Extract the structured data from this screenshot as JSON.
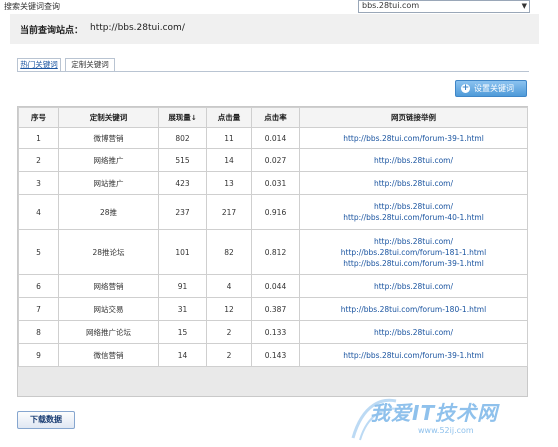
{
  "topbar": {
    "title": "搜索关键词查询",
    "site_select_value": "bbs.28tui.com"
  },
  "site": {
    "label": "当前查询站点：",
    "url": "http://bbs.28tui.com/"
  },
  "tabs": [
    {
      "label": "热门关键词"
    },
    {
      "label": "定制关键词"
    }
  ],
  "set_keywords_button": "设置关键词",
  "table": {
    "headers": [
      "序号",
      "定制关键词",
      "展现量",
      "点击量",
      "点击率",
      "网页链接举例"
    ],
    "sort_indicator": "↓",
    "rows": [
      {
        "no": "1",
        "keyword": "微博营销",
        "impressions": "802",
        "clicks": "11",
        "ctr": "0.014",
        "links": [
          "http://bbs.28tui.com/forum-39-1.html"
        ]
      },
      {
        "no": "2",
        "keyword": "网络推广",
        "impressions": "515",
        "clicks": "14",
        "ctr": "0.027",
        "links": [
          "http://bbs.28tui.com/"
        ]
      },
      {
        "no": "3",
        "keyword": "网站推广",
        "impressions": "423",
        "clicks": "13",
        "ctr": "0.031",
        "links": [
          "http://bbs.28tui.com/"
        ]
      },
      {
        "no": "4",
        "keyword": "28推",
        "impressions": "237",
        "clicks": "217",
        "ctr": "0.916",
        "links": [
          "http://bbs.28tui.com/",
          "http://bbs.28tui.com/forum-40-1.html"
        ]
      },
      {
        "no": "5",
        "keyword": "28推论坛",
        "impressions": "101",
        "clicks": "82",
        "ctr": "0.812",
        "links": [
          "http://bbs.28tui.com/",
          "http://bbs.28tui.com/forum-181-1.html",
          "http://bbs.28tui.com/forum-39-1.html"
        ]
      },
      {
        "no": "6",
        "keyword": "网络营销",
        "impressions": "91",
        "clicks": "4",
        "ctr": "0.044",
        "links": [
          "http://bbs.28tui.com/"
        ]
      },
      {
        "no": "7",
        "keyword": "网站交易",
        "impressions": "31",
        "clicks": "12",
        "ctr": "0.387",
        "links": [
          "http://bbs.28tui.com/forum-180-1.html"
        ]
      },
      {
        "no": "8",
        "keyword": "网络推广论坛",
        "impressions": "15",
        "clicks": "2",
        "ctr": "0.133",
        "links": [
          "http://bbs.28tui.com/"
        ]
      },
      {
        "no": "9",
        "keyword": "微信营销",
        "impressions": "14",
        "clicks": "2",
        "ctr": "0.143",
        "links": [
          "http://bbs.28tui.com/forum-39-1.html"
        ]
      }
    ]
  },
  "download_button": "下载数据",
  "watermark": {
    "main": "我爱IT技术网",
    "sub": "www.52ij.com"
  },
  "colors": {
    "link": "#1a54a0",
    "button_blue": "#4f9ad8",
    "watermark": "#8fc1ec"
  }
}
